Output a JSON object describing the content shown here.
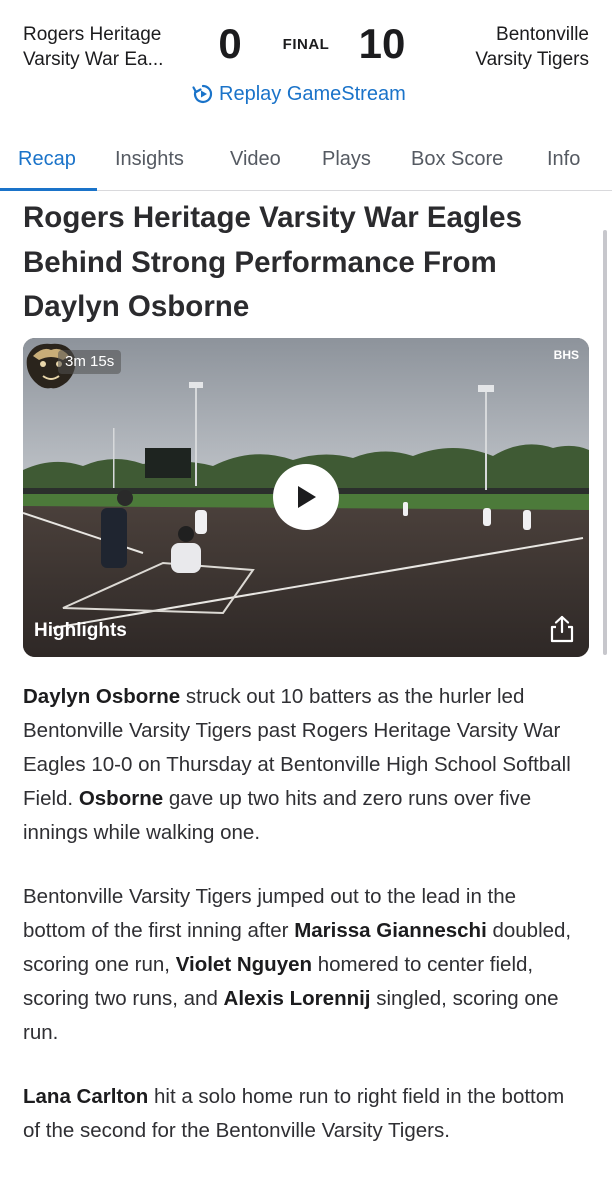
{
  "scoreboard": {
    "home_team_line1": "Rogers Heritage",
    "home_team_line2": "Varsity War Ea...",
    "home_score": "0",
    "status": "FINAL",
    "away_score": "10",
    "away_team_line1": "Bentonville",
    "away_team_line2": "Varsity Tigers",
    "replay_label": "Replay GameStream",
    "replay_icon": "replay-icon"
  },
  "tabs": [
    {
      "label": "Recap",
      "active": true
    },
    {
      "label": "Insights",
      "active": false
    },
    {
      "label": "Video",
      "active": false
    },
    {
      "label": "Plays",
      "active": false
    },
    {
      "label": "Box Score",
      "active": false
    },
    {
      "label": "Info",
      "active": false
    }
  ],
  "article": {
    "headline": "Rogers Heritage Varsity War Eagles Behind Strong Performance From Daylyn Osborne",
    "video": {
      "duration": "3m 15s",
      "source": "BHS",
      "label": "Highlights",
      "play_icon": "play-icon",
      "share_icon": "share-icon"
    },
    "paragraphs": [
      {
        "segments": [
          {
            "text": "Daylyn Osborne",
            "bold": true
          },
          {
            "text": " struck out 10 batters as the hurler led Bentonville Varsity Tigers past Rogers Heritage Varsity War Eagles 10-0 on Thursday at Bentonville High School Softball Field. ",
            "bold": false
          },
          {
            "text": "Osborne",
            "bold": true
          },
          {
            "text": " gave up two hits and zero runs over five innings while walking one.",
            "bold": false
          }
        ]
      },
      {
        "segments": [
          {
            "text": "Bentonville Varsity Tigers jumped out to the lead in the bottom of the first inning after ",
            "bold": false
          },
          {
            "text": "Marissa Gianneschi",
            "bold": true
          },
          {
            "text": " doubled, scoring one run, ",
            "bold": false
          },
          {
            "text": "Violet Nguyen",
            "bold": true
          },
          {
            "text": " homered to center field, scoring two runs, and ",
            "bold": false
          },
          {
            "text": "Alexis Lorennij",
            "bold": true
          },
          {
            "text": " singled, scoring one run.",
            "bold": false
          }
        ]
      },
      {
        "segments": [
          {
            "text": "Lana Carlton",
            "bold": true
          },
          {
            "text": " hit a solo home run to right field in the bottom of the second for the Bentonville Varsity Tigers.",
            "bold": false
          }
        ]
      }
    ]
  },
  "colors": {
    "accent": "#1a73c9",
    "text": "#1c1c1e"
  }
}
